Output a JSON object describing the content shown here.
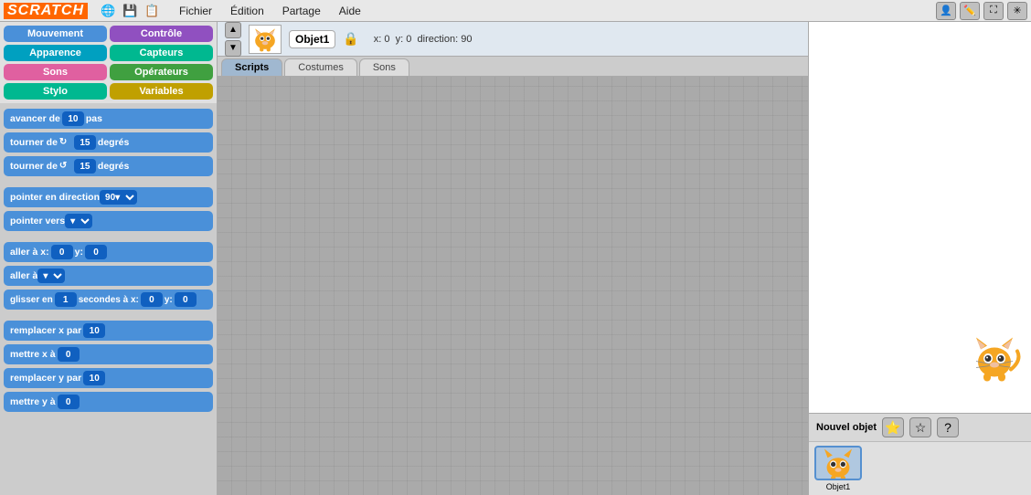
{
  "app": {
    "title": "SCRATCH",
    "logo": "SCRATCH"
  },
  "menubar": {
    "icons": [
      "🌐",
      "💾",
      "📋"
    ],
    "items": [
      "Fichier",
      "Édition",
      "Partage",
      "Aide"
    ],
    "right_icons": [
      "👤",
      "✏️",
      "⛶",
      "✳"
    ]
  },
  "categories": [
    {
      "label": "Mouvement",
      "color": "blue"
    },
    {
      "label": "Contrôle",
      "color": "purple"
    },
    {
      "label": "Apparence",
      "color": "cyan"
    },
    {
      "label": "Capteurs",
      "color": "teal"
    },
    {
      "label": "Sons",
      "color": "pink"
    },
    {
      "label": "Opérateurs",
      "color": "green-dark"
    },
    {
      "label": "Stylo",
      "color": "teal"
    },
    {
      "label": "Variables",
      "color": "gold"
    }
  ],
  "blocks": [
    {
      "id": "avancer",
      "text_before": "avancer de",
      "value": "10",
      "text_after": "pas"
    },
    {
      "id": "tourner_droite",
      "text_before": "tourner de",
      "rotate": "right",
      "value": "15",
      "text_after": "degrés"
    },
    {
      "id": "tourner_gauche",
      "text_before": "tourner de",
      "rotate": "left",
      "value": "15",
      "text_after": "degrés"
    },
    {
      "id": "pointer_direction",
      "text_before": "pointer en direction",
      "value": "90",
      "dropdown": true
    },
    {
      "id": "pointer_vers",
      "text_before": "pointer vers",
      "dropdown_small": true
    },
    {
      "id": "aller_xy",
      "text_before": "aller à x:",
      "x_val": "0",
      "text_mid": "y:",
      "y_val": "0"
    },
    {
      "id": "aller_a",
      "text_before": "aller à",
      "dropdown_small": true
    },
    {
      "id": "glisser",
      "text_before": "glisser en",
      "secs": "1",
      "text2": "secondes à x:",
      "x_val": "0",
      "text3": "y:",
      "y_val": "0"
    },
    {
      "id": "remplacer_x",
      "text_before": "remplacer x par",
      "value": "10"
    },
    {
      "id": "mettre_x",
      "text_before": "mettre x à",
      "value": "0"
    },
    {
      "id": "remplacer_y",
      "text_before": "remplacer y par",
      "value": "10"
    },
    {
      "id": "mettre_y",
      "text_before": "mettre y à",
      "value": "0"
    }
  ],
  "sprite": {
    "name": "Objet1",
    "x": "0",
    "y": "0",
    "direction": "90"
  },
  "tabs": [
    {
      "label": "Scripts",
      "active": true
    },
    {
      "label": "Costumes",
      "active": false
    },
    {
      "label": "Sons",
      "active": false
    }
  ],
  "stage": {
    "new_sprite_label": "Nouvel objet",
    "sprites": [
      {
        "name": "Objet1",
        "selected": true
      }
    ]
  }
}
